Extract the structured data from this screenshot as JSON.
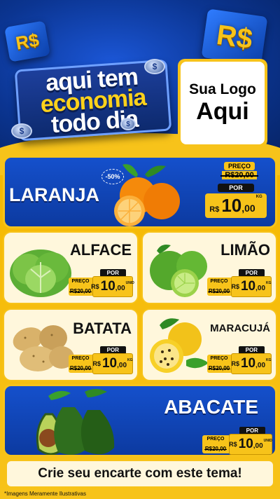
{
  "header": {
    "cube_left": "R$",
    "cube_right": "R$",
    "coin_symbol": "$",
    "slogan": [
      "aqui tem",
      "economia",
      "todo dia"
    ],
    "logo_line1": "Sua Logo",
    "logo_line2": "Aqui"
  },
  "featured": {
    "name": "LARANJA",
    "discount": "-50%",
    "preco_label": "PREÇO",
    "old_price": "R$20,00",
    "por_label": "POR",
    "currency": "R$",
    "price_int": "10",
    "price_dec": ",00",
    "unit": "KG"
  },
  "products": [
    {
      "name": "ALFACE",
      "preco_label": "PREÇO",
      "old_price": "R$20,00",
      "por_label": "POR",
      "currency": "R$",
      "price_int": "10",
      "price_dec": ",00",
      "unit": "UNID"
    },
    {
      "name": "LIMÃO",
      "preco_label": "PREÇO",
      "old_price": "R$20,00",
      "por_label": "POR",
      "currency": "R$",
      "price_int": "10",
      "price_dec": ",00",
      "unit": "KG"
    },
    {
      "name": "BATATA",
      "preco_label": "PREÇO",
      "old_price": "R$20,00",
      "por_label": "POR",
      "currency": "R$",
      "price_int": "10",
      "price_dec": ",00",
      "unit": "KG"
    },
    {
      "name": "MARACUJÁ",
      "preco_label": "PREÇO",
      "old_price": "R$20,00",
      "por_label": "POR",
      "currency": "R$",
      "price_int": "10",
      "price_dec": ",00",
      "unit": "KG"
    }
  ],
  "bottom": {
    "name": "ABACATE",
    "preco_label": "PREÇO",
    "old_price": "R$20,00",
    "por_label": "POR",
    "currency": "R$",
    "price_int": "10",
    "price_dec": ",00",
    "unit": "UNID"
  },
  "cta": "Crie seu encarte com este tema!",
  "disclaimer": "*Imagens Meramente Ilustrativas",
  "colors": {
    "blue": "#0c3aa0",
    "yellow": "#f7c31a",
    "cream": "#fff7dc"
  }
}
